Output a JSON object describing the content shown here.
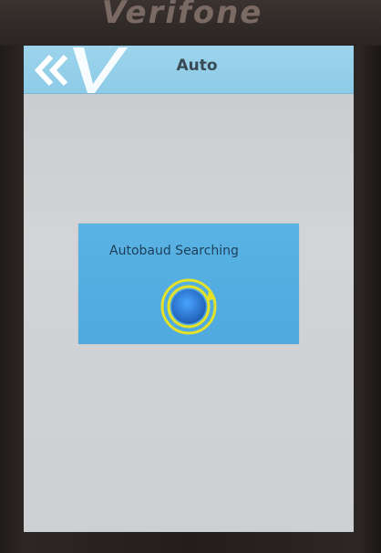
{
  "device": {
    "brand": "Verifone"
  },
  "header": {
    "title": "Auto",
    "back_icon": "double-chevron-left-icon",
    "logo_icon": "verifone-v-logo-icon"
  },
  "dialog": {
    "message": "Autobaud Searching",
    "spinner_icon": "circular-progress-icon"
  },
  "colors": {
    "title_bar": "#9ed4ec",
    "dialog_bg": "#4fa9df",
    "spinner_ring": "#e3e12a",
    "spinner_core": "#2f7fd2",
    "screen_bg": "#cdd0d3"
  }
}
